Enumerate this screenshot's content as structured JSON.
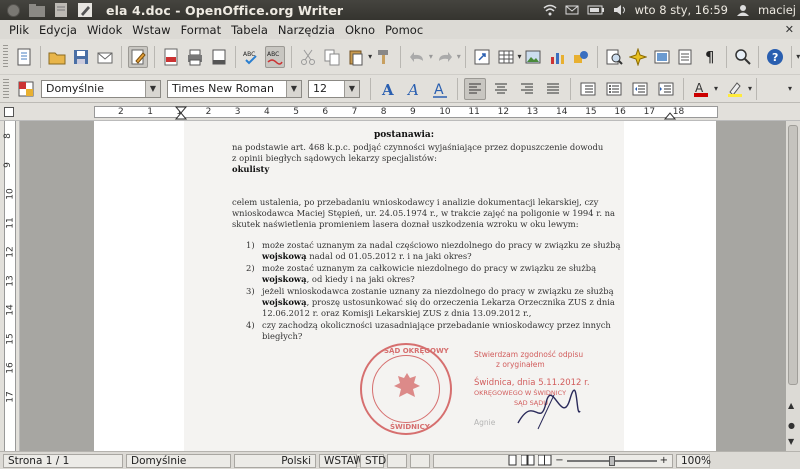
{
  "window": {
    "title": "ela 4.doc - OpenOffice.org Writer"
  },
  "panel": {
    "datetime": "wto  8 sty, 16:59",
    "user": "maciej"
  },
  "menu": [
    "Plik",
    "Edycja",
    "Widok",
    "Wstaw",
    "Format",
    "Tabela",
    "Narzędzia",
    "Okno",
    "Pomoc"
  ],
  "formatting": {
    "style": "Domyślnie",
    "font": "Times New Roman",
    "size": "12"
  },
  "ruler": {
    "h_labels": [
      "2",
      "1",
      "1",
      "2",
      "3",
      "4",
      "5",
      "6",
      "7",
      "8",
      "9",
      "10",
      "11",
      "12",
      "13",
      "14",
      "15",
      "16",
      "17",
      "18"
    ],
    "v_labels": [
      "8",
      "9",
      "10",
      "11",
      "12",
      "13",
      "14",
      "15",
      "16",
      "17"
    ]
  },
  "document": {
    "heading": "postanawia:",
    "lines": [
      "na podstawie art. 468 k.p.c. podjąć czynności wyjaśniające przez dopuszczenie dowodu",
      "z opinii biegłych sądowych lekarzy specjalistów:"
    ],
    "specialty": "okulisty",
    "para": [
      "celem ustalenia, po przebadaniu wnioskodawcy i analizie dokumentacji lekarskiej, czy",
      "wnioskodawca Maciej Stępień, ur. 24.05.1974 r., w trakcie zajęć na poligonie w 1994 r. na",
      "skutek naświetlenia promieniem lasera doznał uszkodzenia wzroku w oku lewym:"
    ],
    "items": [
      {
        "num": "1)",
        "l1": "może zostać uznanym za nadal częściowo niezdolnego do pracy w związku ze służbą",
        "l2a": "wojskową",
        "l2b": " nadal od 01.05.2012 r. i na jaki okres?"
      },
      {
        "num": "2)",
        "l1": "może zostać uznanym za całkowicie niezdolnego do pracy w związku ze służbą",
        "l2a": "wojskową",
        "l2b": ", od kiedy i na jaki okres?"
      },
      {
        "num": "3)",
        "l1": "jeżeli wnioskodawca zostanie uznany za niezdolnego do pracy w związku ze służbą",
        "l2a": "wojskową",
        "l2b": ", proszę ustosunkować się do orzeczenia Lekarza Orzecznika ZUS z dnia",
        "l3": "12.06.2012 r. oraz Komisji Lekarskiej ZUS z dnia 13.09.2012 r.,"
      },
      {
        "num": "4)",
        "l1": "czy zachodzą okoliczności uzasadniające przebadanie wnioskodawcy przez innych",
        "l2a": "",
        "l2b": "biegłych?"
      }
    ],
    "stamp_text": "SĄD OKRĘGOWY",
    "stamp_city": "ŚWIDNICY",
    "cert_lines": [
      "Stwierdzam zgodność odpisu",
      "z oryginałem",
      "Świdnica, dnia 5.11.2012 r.",
      "OKRĘGOWEGO W ŚWIDNICY",
      "SĄD SĄDU",
      "Agnie"
    ]
  },
  "status": {
    "page": "Strona  1 / 1",
    "style": "Domyślnie",
    "lang": "Polski",
    "insert": "WSTAW",
    "std": "STD",
    "zoom": "100%"
  },
  "colors": {
    "accent": "#f07746",
    "panel": "#3c3b37",
    "stamp": "#c44444"
  }
}
